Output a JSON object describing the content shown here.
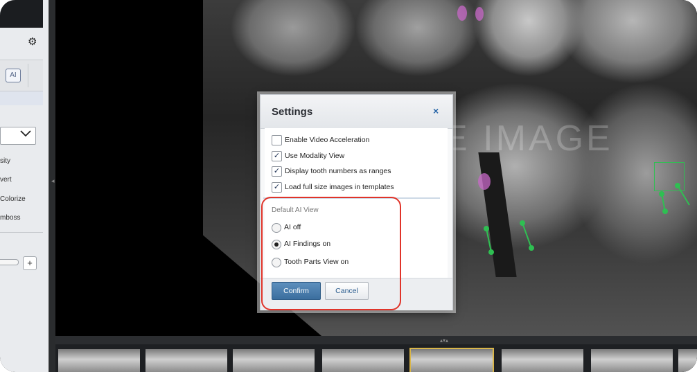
{
  "left_panel": {
    "tools": [
      "sity",
      "vert",
      "Colorize",
      "mboss"
    ],
    "ai_toggle_label": "AI",
    "plus_label": "+",
    "gear_icon": "gear-icon",
    "dropdown_icon": "chevron-down-icon"
  },
  "viewer": {
    "watermark": "E IMAGE",
    "annotation_color": "#2fbf52",
    "highlight_color": "#c868c8"
  },
  "dialog": {
    "title": "Settings",
    "close_label": "×",
    "checkboxes": [
      {
        "label": "Enable Video Acceleration",
        "checked": false
      },
      {
        "label": "Use Modality View",
        "checked": true
      },
      {
        "label": "Display tooth numbers as ranges",
        "checked": true
      },
      {
        "label": "Load full size images in templates",
        "checked": true
      }
    ],
    "ai_section_label": "Default AI View",
    "radios": [
      {
        "label": "AI off",
        "selected": false
      },
      {
        "label": "AI Findings on",
        "selected": true
      },
      {
        "label": "Tooth Parts View on",
        "selected": false
      }
    ],
    "confirm_label": "Confirm",
    "cancel_label": "Cancel",
    "accent_color": "#3b6e9e"
  },
  "annotation_box_color": "#e0342a"
}
